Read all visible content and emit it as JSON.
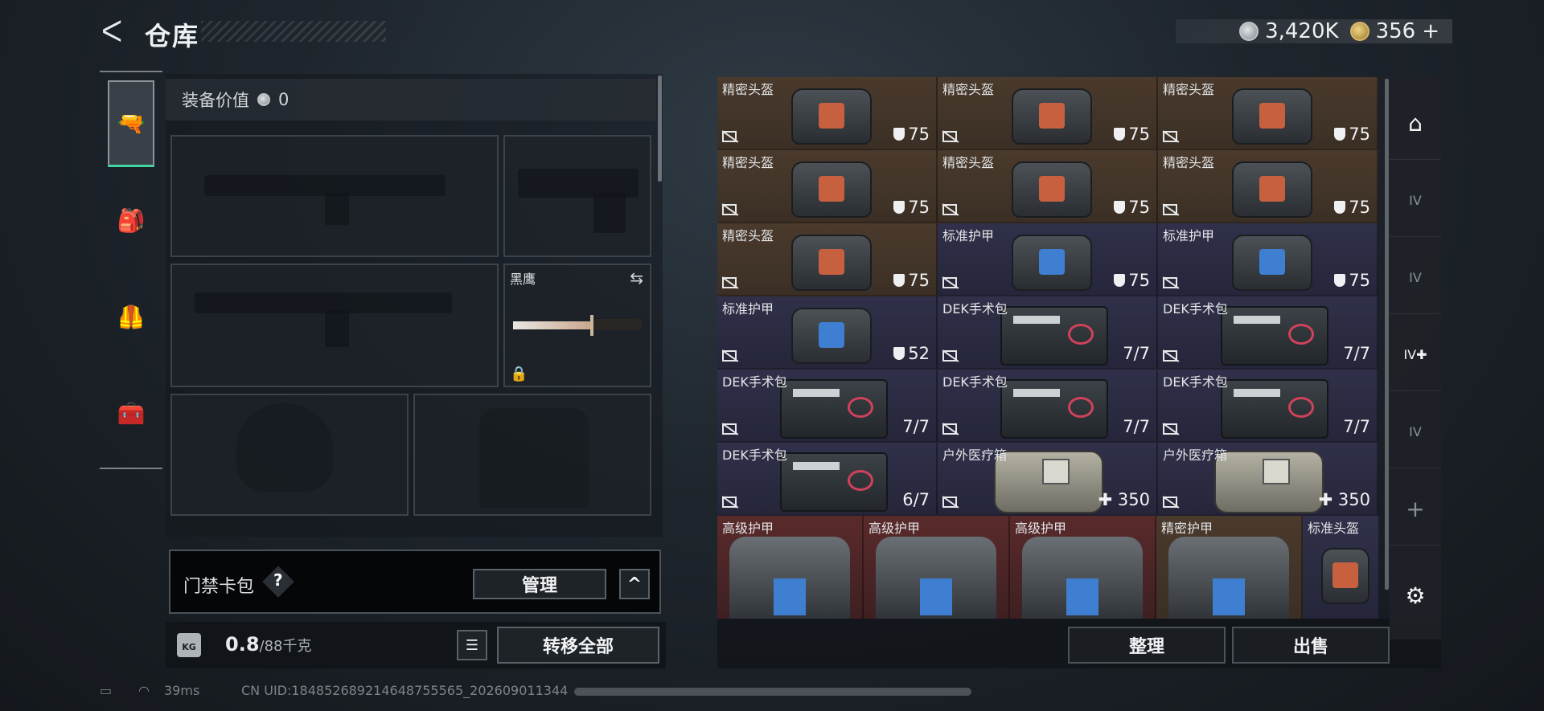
{
  "header": {
    "title": "仓库",
    "currency": [
      {
        "icon": "silver-coin-icon",
        "value": "3,420K"
      },
      {
        "icon": "gold-coin-icon",
        "value": "356"
      }
    ],
    "add_label": "+"
  },
  "left_sidebar": {
    "items": [
      {
        "name": "pistol-tab",
        "glyph": "🔫",
        "active": true
      },
      {
        "name": "backpack-tab",
        "glyph": "🎒",
        "active": false
      },
      {
        "name": "vest-tab",
        "glyph": "🦺",
        "active": false
      },
      {
        "name": "toolbox-tab",
        "glyph": "🧰",
        "active": false
      }
    ]
  },
  "equipment": {
    "value_label": "装备价值",
    "value": "0",
    "knife_name": "黑鹰"
  },
  "keycard": {
    "label": "门禁卡包",
    "help": "?",
    "manage_label": "管理",
    "collapse_glyph": "^"
  },
  "weight": {
    "icon_label": "KG",
    "current": "0.8",
    "max": "/88千克",
    "transfer_label": "转移全部"
  },
  "inventory": {
    "rows": [
      [
        {
          "name": "精密头盔",
          "type": "helmet",
          "color": "brown",
          "value": "75",
          "shield": true
        },
        {
          "name": "精密头盔",
          "type": "helmet",
          "color": "brown",
          "value": "75",
          "shield": true
        },
        {
          "name": "精密头盔",
          "type": "helmet",
          "color": "brown",
          "value": "75",
          "shield": true
        }
      ],
      [
        {
          "name": "精密头盔",
          "type": "helmet",
          "color": "brown",
          "value": "75",
          "shield": true
        },
        {
          "name": "精密头盔",
          "type": "helmet",
          "color": "brown",
          "value": "75",
          "shield": true
        },
        {
          "name": "精密头盔",
          "type": "helmet",
          "color": "brown",
          "value": "75",
          "shield": true
        }
      ],
      [
        {
          "name": "精密头盔",
          "type": "helmet",
          "color": "brown",
          "value": "75",
          "shield": true
        },
        {
          "name": "标准护甲",
          "type": "armor",
          "color": "blue",
          "value": "75",
          "shield": true
        },
        {
          "name": "标准护甲",
          "type": "armor",
          "color": "blue",
          "value": "75",
          "shield": true
        }
      ],
      [
        {
          "name": "标准护甲",
          "type": "armor",
          "color": "blue",
          "value": "52",
          "shield": true
        },
        {
          "name": "DEK手术包",
          "type": "kit",
          "color": "blue",
          "value": "7/7",
          "shield": false
        },
        {
          "name": "DEK手术包",
          "type": "kit",
          "color": "blue",
          "value": "7/7",
          "shield": false
        }
      ],
      [
        {
          "name": "DEK手术包",
          "type": "kit",
          "color": "blue",
          "value": "7/7",
          "shield": false
        },
        {
          "name": "DEK手术包",
          "type": "kit",
          "color": "blue",
          "value": "7/7",
          "shield": false
        },
        {
          "name": "DEK手术包",
          "type": "kit",
          "color": "blue",
          "value": "7/7",
          "shield": false
        }
      ],
      [
        {
          "name": "DEK手术包",
          "type": "kit",
          "color": "blue",
          "value": "6/7",
          "shield": false
        },
        {
          "name": "户外医疗箱",
          "type": "medbox",
          "color": "blue",
          "value": "✚ 350",
          "shield": false
        },
        {
          "name": "户外医疗箱",
          "type": "medbox",
          "color": "blue",
          "value": "✚ 350",
          "shield": false
        }
      ]
    ],
    "bottom_row": [
      {
        "name": "高级护甲",
        "color": "red"
      },
      {
        "name": "高级护甲",
        "color": "red"
      },
      {
        "name": "高级护甲",
        "color": "red"
      },
      {
        "name": "精密护甲",
        "color": "brown"
      },
      {
        "name": "标准头盔",
        "color": "blue"
      }
    ],
    "sort_label": "整理",
    "sell_label": "出售"
  },
  "right_sidebar": {
    "items": [
      {
        "name": "stash-tab",
        "glyph": "⌂"
      },
      {
        "name": "tier4-weapon-tab",
        "glyph": "IV"
      },
      {
        "name": "tier4-ammo-tab",
        "glyph": "IV"
      },
      {
        "name": "tier4-medical-tab",
        "glyph": "IV✚"
      },
      {
        "name": "tier4-gear-tab",
        "glyph": "IV"
      },
      {
        "name": "add-tab",
        "glyph": "+"
      }
    ],
    "settings_glyph": "⚙"
  },
  "status": {
    "ping": "39ms",
    "uid": "CN UID:184852689214648755565_202609011344"
  }
}
